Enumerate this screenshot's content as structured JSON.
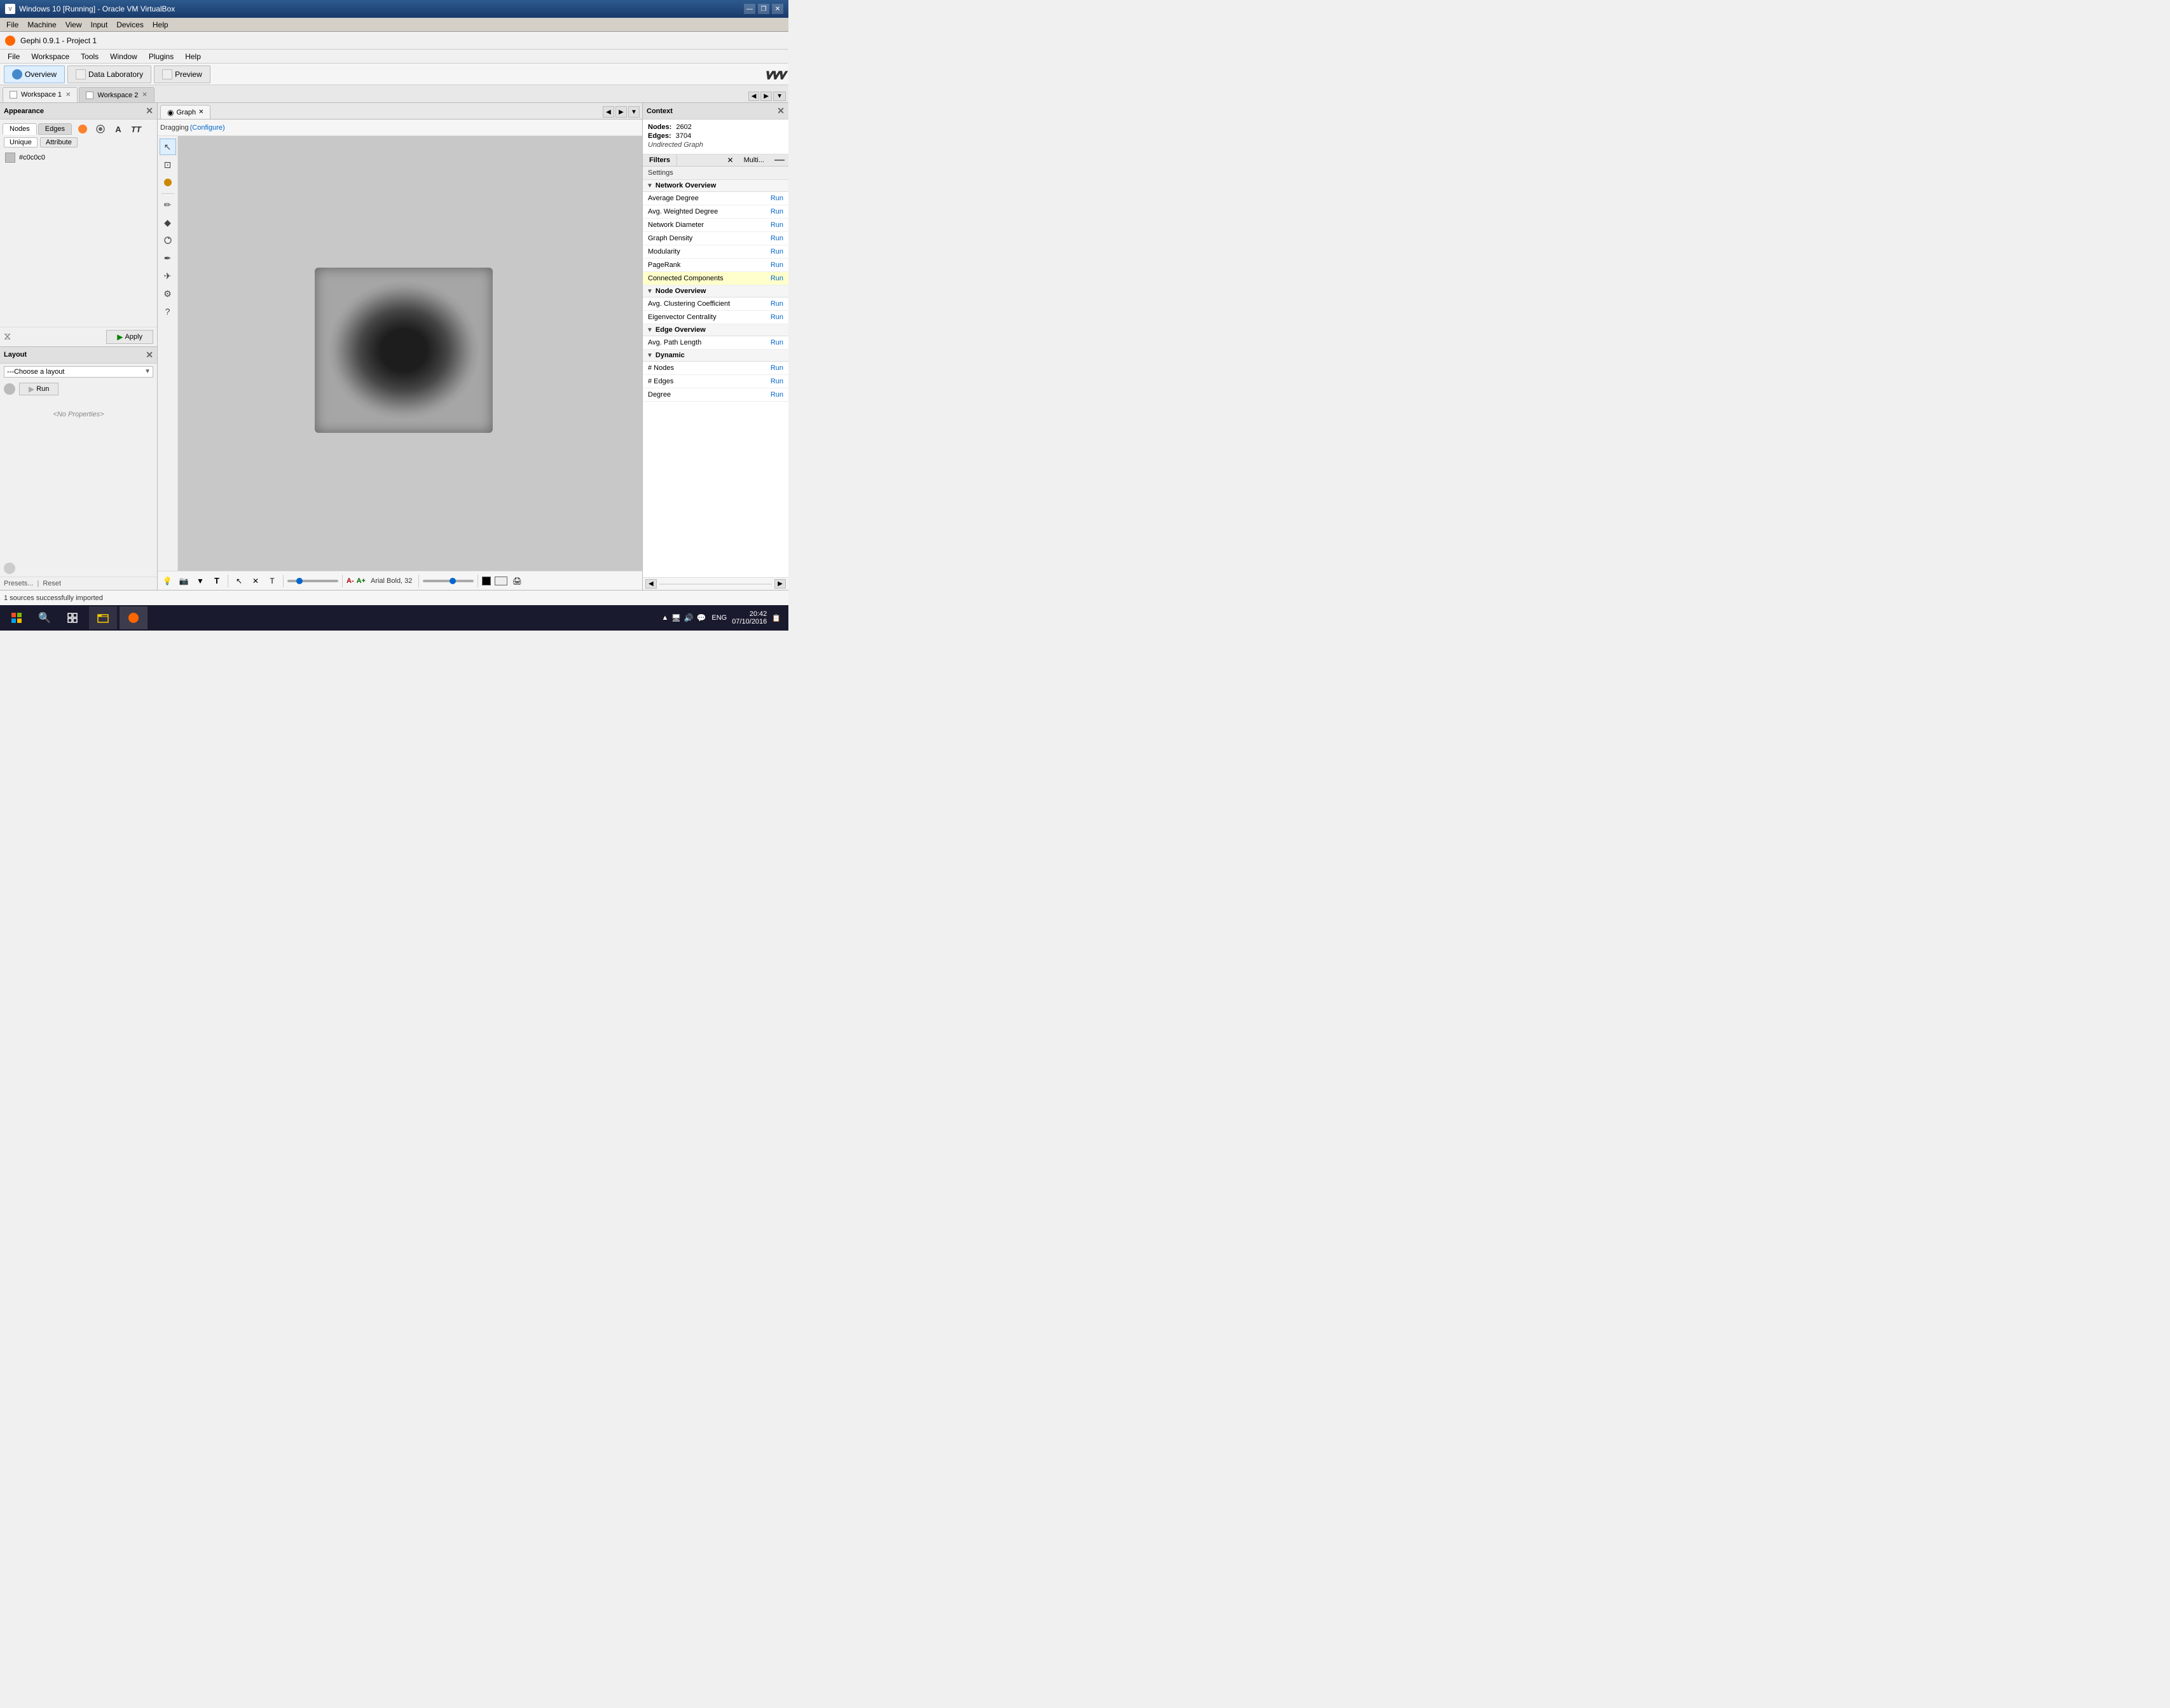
{
  "titlebar": {
    "title": "Windows 10 [Running] - Oracle VM VirtualBox",
    "minimize": "—",
    "restore": "❐",
    "close": "✕"
  },
  "vm_menu": {
    "items": [
      "File",
      "Machine",
      "View",
      "Input",
      "Devices",
      "Help"
    ]
  },
  "app": {
    "title": "Gephi 0.9.1 - Project 1",
    "menu_items": [
      "File",
      "Workspace",
      "Tools",
      "Window",
      "Plugins",
      "Help"
    ]
  },
  "toolbar": {
    "overview_label": "Overview",
    "datalabs_label": "Data Laboratory",
    "preview_label": "Preview"
  },
  "workspaces": {
    "tab1": "Workspace 1",
    "tab2": "Workspace 2"
  },
  "appearance": {
    "panel_title": "Appearance",
    "nodes_label": "Nodes",
    "edges_label": "Edges",
    "unique_label": "Unique",
    "attribute_label": "Attribute",
    "color_hex": "#c0c0c0",
    "apply_label": "Apply",
    "link_icon": "⧖"
  },
  "layout": {
    "panel_title": "Layout",
    "choose_layout": "---Choose a layout",
    "run_label": "Run",
    "no_properties": "<No Properties>",
    "presets_label": "Presets...",
    "reset_label": "Reset"
  },
  "graph": {
    "panel_title": "Graph",
    "dragging_label": "Dragging",
    "configure_label": "(Configure)"
  },
  "context": {
    "panel_title": "Context",
    "nodes_label": "Nodes:",
    "nodes_value": "2602",
    "edges_label": "Edges:",
    "edges_value": "3704",
    "graph_type": "Undirected Graph"
  },
  "filters": {
    "tab_label": "Filters",
    "multi_label": "Multi...",
    "settings_label": "Settings"
  },
  "stats": {
    "network_overview_label": "Network Overview",
    "items": [
      {
        "label": "Average Degree",
        "action": "Run"
      },
      {
        "label": "Avg. Weighted Degree",
        "action": "Run"
      },
      {
        "label": "Network Diameter",
        "action": "Run"
      },
      {
        "label": "Graph Density",
        "action": "Run"
      },
      {
        "label": "Modularity",
        "action": "Run"
      },
      {
        "label": "PageRank",
        "action": "Run"
      },
      {
        "label": "Connected Components",
        "action": "Run"
      }
    ],
    "node_overview_label": "Node Overview",
    "node_items": [
      {
        "label": "Avg. Clustering Coefficient",
        "action": "Run"
      },
      {
        "label": "Eigenvector Centrality",
        "action": "Run"
      }
    ],
    "edge_overview_label": "Edge Overview",
    "edge_items": [
      {
        "label": "Avg. Path Length",
        "action": "Run"
      }
    ],
    "dynamic_label": "Dynamic",
    "dynamic_items": [
      {
        "label": "# Nodes",
        "action": "Run"
      },
      {
        "label": "# Edges",
        "action": "Run"
      },
      {
        "label": "Degree",
        "action": "Run"
      }
    ]
  },
  "bottom_toolbar": {
    "font_label": "Arial Bold, 32",
    "a_plus": "A+",
    "a_minus": "A-"
  },
  "status": {
    "message": "1 sources successfully imported"
  },
  "taskbar": {
    "time": "20:42",
    "date": "07/10/2016",
    "lang": "ENG"
  },
  "tools": {
    "select": "↖",
    "rect_select": "⊡",
    "drag": "✋",
    "pencil": "✏",
    "gem": "◆",
    "rotate": "↻",
    "pen2": "✒",
    "plane": "✈",
    "gear": "⚙",
    "question": "?"
  }
}
